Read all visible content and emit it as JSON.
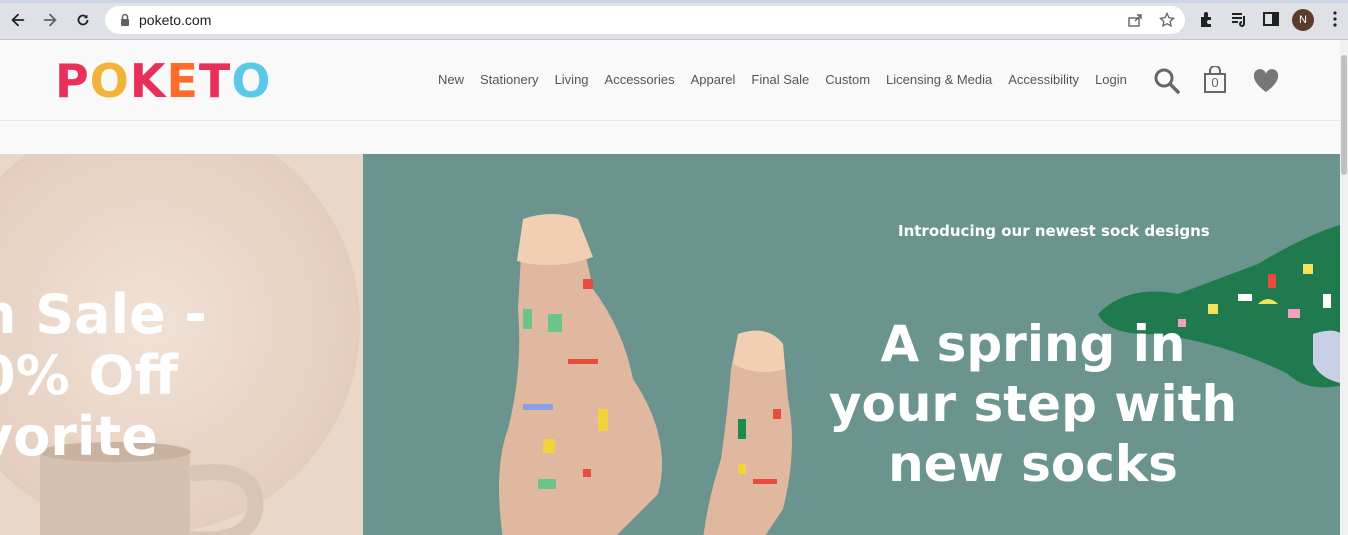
{
  "browser": {
    "url": "poketo.com",
    "profile_initial": "N"
  },
  "site": {
    "logo_letters": [
      "P",
      "O",
      "K",
      "E",
      "T",
      "O"
    ],
    "logo_colors": [
      "#e8305a",
      "#f2e24a",
      "#e8305a",
      "#ff6b2b",
      "#5cc8e8",
      "#7cc1e8"
    ],
    "nav": [
      "New",
      "Stationery",
      "Living",
      "Accessories",
      "Apparel",
      "Final Sale",
      "Custom",
      "Licensing & Media",
      "Accessibility",
      "Login"
    ],
    "cart_count": "0"
  },
  "hero_left": {
    "lines": [
      "n Sale -",
      "0% Off",
      "vorite"
    ]
  },
  "hero_right": {
    "intro": "Introducing our newest sock designs",
    "headline_lines": [
      "A spring in",
      "your step with",
      "new socks"
    ]
  },
  "colors": {
    "teal": "#6a948d",
    "peach": "#e9d7ca",
    "sock_green": "#1f7a4d"
  }
}
